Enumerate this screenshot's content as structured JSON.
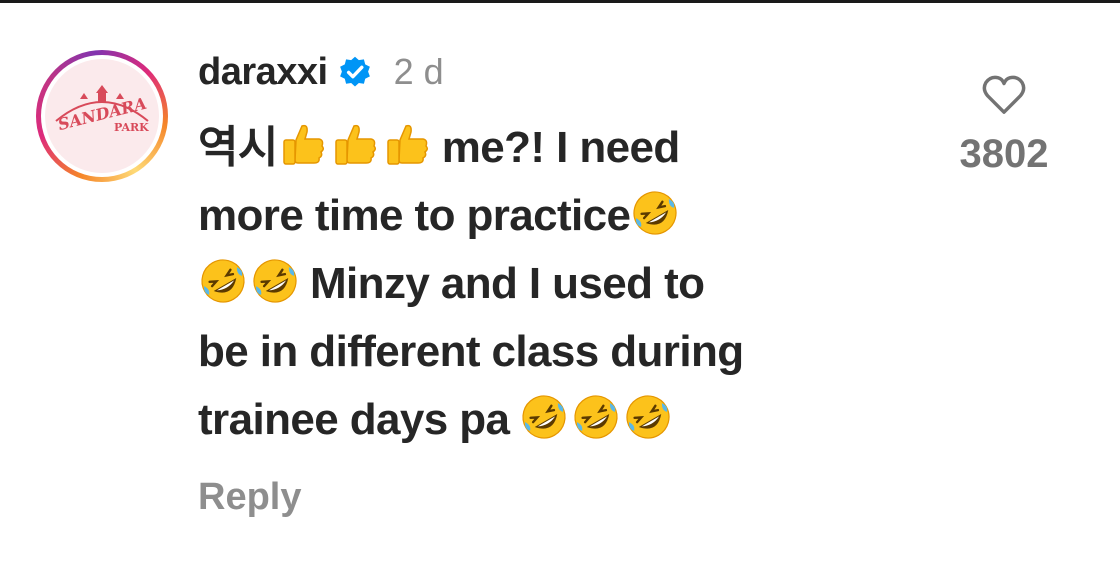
{
  "comment": {
    "username": "daraxxi",
    "timestamp": "2 d",
    "avatar": {
      "logo_text": "SANDARA PARK"
    },
    "body_lines": {
      "l1_a": "역시",
      "l1_b": "me?! I need",
      "l2_a": "more time to practice",
      "l3_a": "Minzy and I used to",
      "l4_a": "be in different class during",
      "l5_a": "trainee days pa"
    },
    "emoji_names": [
      "thumbs-up",
      "rolling-on-the-floor-laughing"
    ],
    "reply_label": "Reply",
    "like_count": "3802"
  },
  "colors": {
    "text": "#262626",
    "muted": "#8e8e8e",
    "count": "#737373",
    "verified": "#0095f6",
    "emoji_yellow": "#fcc21b"
  }
}
